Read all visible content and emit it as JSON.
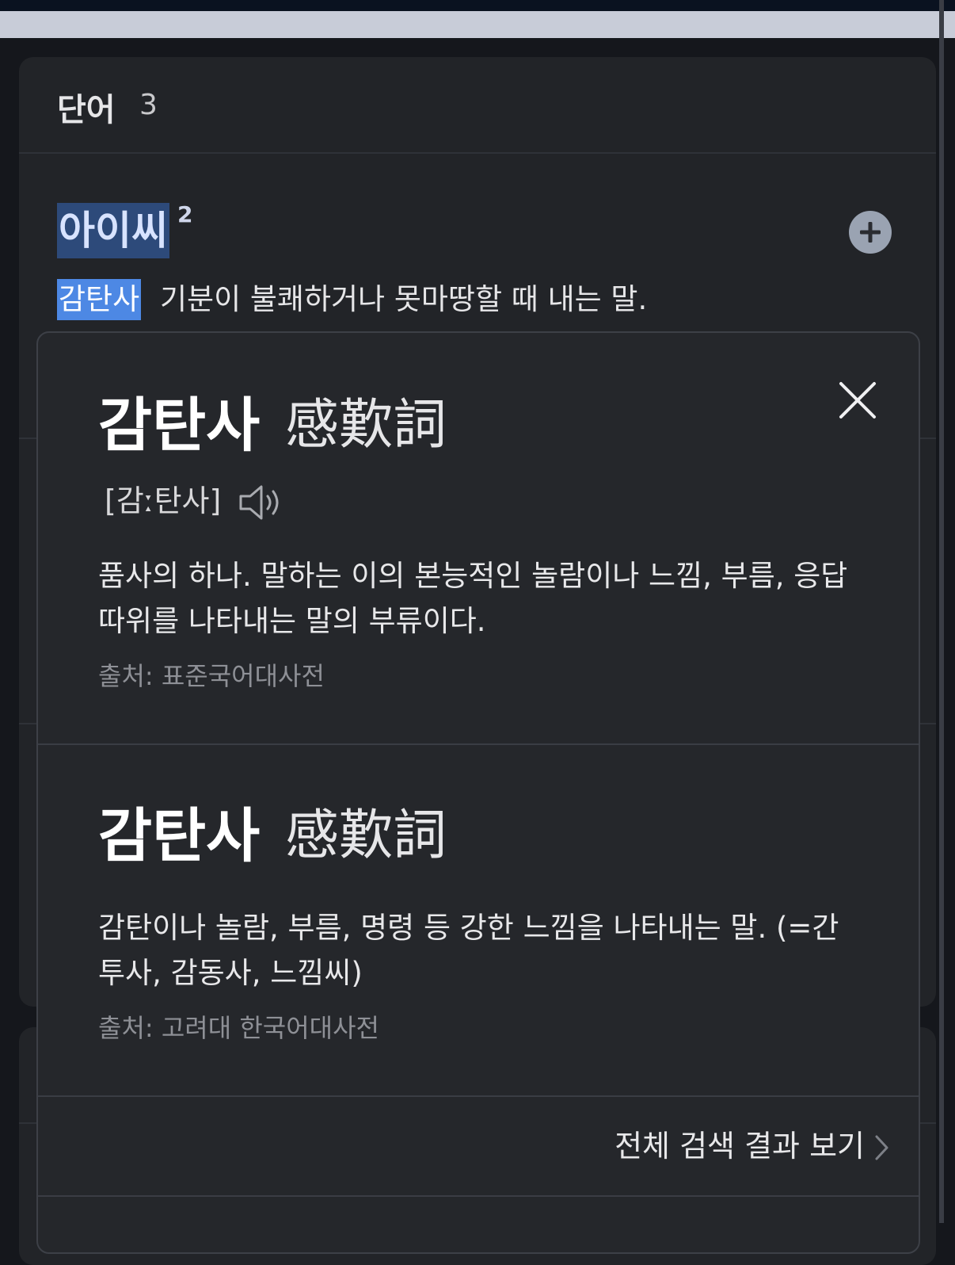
{
  "section": {
    "title": "단어",
    "count": "3"
  },
  "entry": {
    "headword": "아이씨",
    "homonym_number": "2",
    "add_label": "+",
    "pos": "감탄사",
    "definition": "기분이 불쾌하거나 못마땅할 때 내는 말."
  },
  "popup": {
    "entries": [
      {
        "word": "감탄사",
        "hanja": "感歎詞",
        "pronunciation": "[감ː탄사]",
        "definition": "품사의 하나. 말하는 이의 본능적인 놀람이나 느낌, 부름, 응답 따위를 나타내는 말의 부류이다.",
        "source": "출처: 표준국어대사전"
      },
      {
        "word": "감탄사",
        "hanja": "感歎詞",
        "definition": "감탄이나 놀람, 부름, 명령 등 강한 느낌을 나타내는 말. (=간투사, 감동사, 느낌씨)",
        "source": "출처: 고려대 한국어대사전"
      }
    ],
    "see_all_label": "전체 검색 결과 보기"
  },
  "icons": {
    "add": "plus-circle-icon",
    "close": "close-icon",
    "speaker": "speaker-icon",
    "chevron": "chevron-right-icon"
  },
  "colors": {
    "background": "#15171c",
    "card": "#222428",
    "popup": "#25272b",
    "highlight_headword": "#2d4a7a",
    "highlight_pos": "#4d88e4",
    "add_button": "#9aa3b2",
    "source_text": "#8e9096"
  }
}
